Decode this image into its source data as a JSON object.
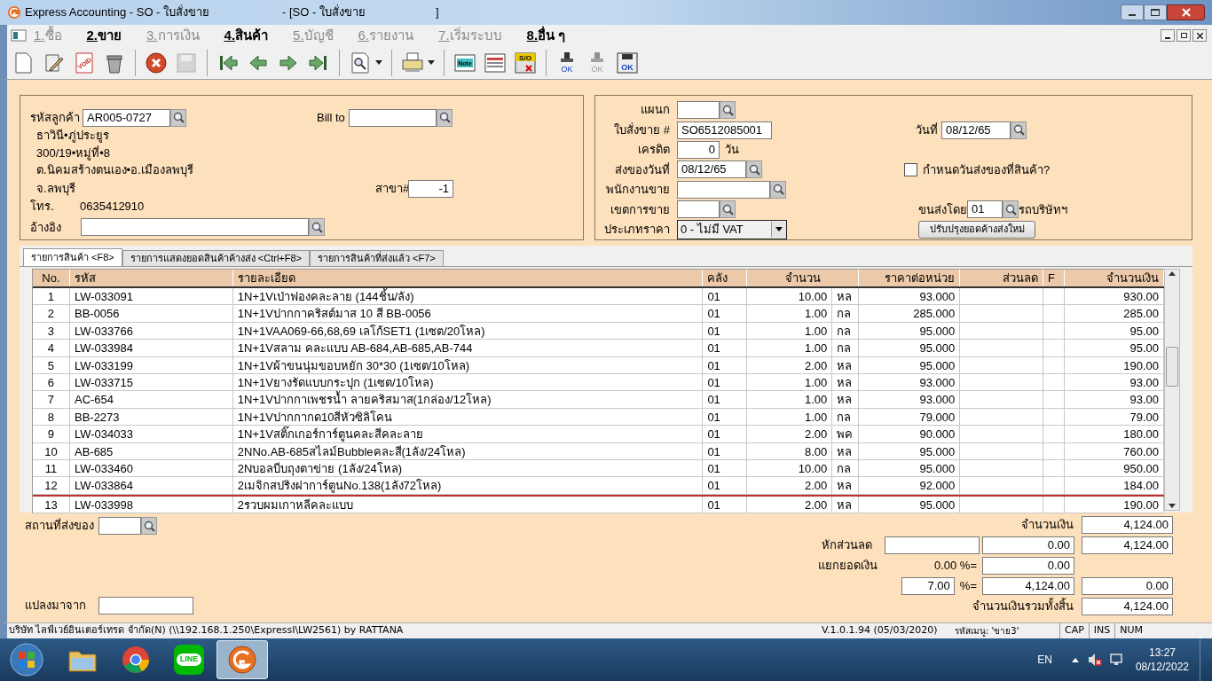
{
  "window": {
    "title": "Express Accounting - SO - ใบสั่งขาย",
    "doc_title": "- [SO - ใบสั่งขาย",
    "doc_title_end": "]"
  },
  "menu": [
    {
      "label": "1.ซื้อ",
      "disabled": true
    },
    {
      "label": "2.ขาย",
      "disabled": false
    },
    {
      "label": "3.การเงิน",
      "disabled": true
    },
    {
      "label": "4.สินค้า",
      "disabled": false
    },
    {
      "label": "5.บัญชี",
      "disabled": true
    },
    {
      "label": "6.รายงาน",
      "disabled": true
    },
    {
      "label": "7.เริ่มระบบ",
      "disabled": true
    },
    {
      "label": "8.อื่น ๆ",
      "disabled": false
    }
  ],
  "toolbar": [
    {
      "kind": "new",
      "disabled": false
    },
    {
      "kind": "edit",
      "disabled": false
    },
    {
      "kind": "void",
      "text": "VOID",
      "disabled": false
    },
    {
      "kind": "trash",
      "disabled": false
    },
    {
      "kind": "sep"
    },
    {
      "kind": "cancel",
      "disabled": false
    },
    {
      "kind": "save",
      "disabled": true
    },
    {
      "kind": "sep"
    },
    {
      "kind": "first",
      "disabled": false
    },
    {
      "kind": "prev",
      "disabled": false
    },
    {
      "kind": "next",
      "disabled": false
    },
    {
      "kind": "last",
      "disabled": false
    },
    {
      "kind": "sep"
    },
    {
      "kind": "find",
      "disabled": false,
      "dropdown": true
    },
    {
      "kind": "sep"
    },
    {
      "kind": "print",
      "disabled": false,
      "dropdown": true
    },
    {
      "kind": "sep"
    },
    {
      "kind": "note",
      "text": "Note",
      "disabled": false
    },
    {
      "kind": "form",
      "disabled": false
    },
    {
      "kind": "so",
      "text": "S/O",
      "disabled": false
    },
    {
      "kind": "sep"
    },
    {
      "kind": "stamp",
      "text": "OK",
      "disabled": false
    },
    {
      "kind": "stamp",
      "text": "OK",
      "disabled": true
    },
    {
      "kind": "okbox",
      "text": "OK",
      "disabled": false
    }
  ],
  "customer": {
    "code_label": "รหัสลูกค้า",
    "code": "AR005-0727",
    "bill_to_label": "Bill to",
    "address_lines": [
      "ธาวินี•ภู่ประยูร",
      "300/19•หมู่ที่•8",
      "ต.นิคมสร้างตนเอง•อ.เมืองลพบุรี",
      "จ.ลพบุรี"
    ],
    "branch_label": "สาขา#",
    "branch": "-1",
    "phone_label": "โทร.",
    "phone": "0635412910",
    "ref_label": "อ้างอิง"
  },
  "order": {
    "department_label": "แผนก",
    "so_label": "ใบสั่งขาย #",
    "so_number": "SO6512085001",
    "date_label": "วันที่",
    "date": "08/12/65",
    "credit_label": "เครดิต",
    "credit": "0",
    "credit_unit": "วัน",
    "ship_date_label": "ส่งของวันที่",
    "ship_date": "08/12/65",
    "set_ship_date": {
      "label": "กำหนดวันส่งของที่สินค้า?",
      "checked": false
    },
    "salesperson_label": "พนักงานขาย",
    "area_label": "เขตการขาย",
    "transport_label": "ขนส่งโดย",
    "transport_code": "01",
    "transport_name": "รถบริษัทฯ",
    "price_type_label": "ประเภทราคา",
    "price_type": "0 - ไม่มี VAT",
    "refresh_button": "ปรับปรุงยอดค้างส่งใหม่"
  },
  "tabs": [
    {
      "label": "รายการสินค้า <F8>",
      "selected": true
    },
    {
      "label": "รายการแสดงยอดสินค้าค้างส่ง  <Ctrl+F8>",
      "selected": false
    },
    {
      "label": "รายการสินค้าที่ส่งแล้ว <F7>",
      "selected": false
    }
  ],
  "table": {
    "columns": [
      "No.",
      "รหัส",
      "รายละเอียด",
      "คลัง",
      "จำนวน",
      "ราคาต่อหน่วย",
      "ส่วนลด",
      "F",
      "จำนวนเงิน"
    ],
    "rows": [
      {
        "no": "1",
        "code": "LW-033091",
        "desc": "1N+1Vเป่าฟองคละลาย (144ชิ้น/ลัง)",
        "wh": "01",
        "qty": "10.00",
        "unit": "หล",
        "price": "93.000",
        "amount": "930.00",
        "current": false
      },
      {
        "no": "2",
        "code": "BB-0056",
        "desc": "1N+1Vปากกาคริสต์มาส 10 สี BB-0056",
        "wh": "01",
        "qty": "1.00",
        "unit": "กล",
        "price": "285.000",
        "amount": "285.00",
        "current": false
      },
      {
        "no": "3",
        "code": "LW-033766",
        "desc": "1N+1VAA069-66,68,69 เลโก้SET1  (1เซต/20โหล)",
        "wh": "01",
        "qty": "1.00",
        "unit": "กล",
        "price": "95.000",
        "amount": "95.00",
        "current": false
      },
      {
        "no": "4",
        "code": "LW-033984",
        "desc": "1N+1Vสลาม คละแบบ AB-684,AB-685,AB-744",
        "wh": "01",
        "qty": "1.00",
        "unit": "กล",
        "price": "95.000",
        "amount": "95.00",
        "current": false
      },
      {
        "no": "5",
        "code": "LW-033199",
        "desc": "1N+1Vผ้าขนนุ่มขอบหยัก 30*30 (1เซต/10โหล)",
        "wh": "01",
        "qty": "2.00",
        "unit": "หล",
        "price": "95.000",
        "amount": "190.00",
        "current": false
      },
      {
        "no": "6",
        "code": "LW-033715",
        "desc": "1N+1Vยางรัดแบบกระปุก (1เซต/10โหล)",
        "wh": "01",
        "qty": "1.00",
        "unit": "หล",
        "price": "93.000",
        "amount": "93.00",
        "current": false
      },
      {
        "no": "7",
        "code": "AC-654",
        "desc": "1N+1Vปากกาเพชรน้ำ ลายคริสมาส(1กล่อง/12โหล)",
        "wh": "01",
        "qty": "1.00",
        "unit": "หล",
        "price": "93.000",
        "amount": "93.00",
        "current": false
      },
      {
        "no": "8",
        "code": "BB-2273",
        "desc": "1N+1Vปากกากด10สีหัวซิลิโคน",
        "wh": "01",
        "qty": "1.00",
        "unit": "กล",
        "price": "79.000",
        "amount": "79.00",
        "current": false
      },
      {
        "no": "9",
        "code": "LW-034033",
        "desc": "1N+1Vสติ๊กเกอร์การ์ตูนคละสีคละลาย",
        "wh": "01",
        "qty": "2.00",
        "unit": "พค",
        "price": "90.000",
        "amount": "180.00",
        "current": false
      },
      {
        "no": "10",
        "code": "AB-685",
        "desc": "2NNo.AB-685สไลม์Bubbleคละสี(1ลัง/24โหล)",
        "wh": "01",
        "qty": "8.00",
        "unit": "หล",
        "price": "95.000",
        "amount": "760.00",
        "current": false
      },
      {
        "no": "11",
        "code": "LW-033460",
        "desc": "2Nบอลบีบถุงตาข่าย (1ลัง/24โหล)",
        "wh": "01",
        "qty": "10.00",
        "unit": "กล",
        "price": "95.000",
        "amount": "950.00",
        "current": false
      },
      {
        "no": "12",
        "code": "LW-033864",
        "desc": "2เมจิกสปริงฝาการ์ตูนNo.138(1ลัง72โหล)",
        "wh": "01",
        "qty": "2.00",
        "unit": "หล",
        "price": "92.000",
        "amount": "184.00",
        "current": false
      },
      {
        "no": "13",
        "code": "LW-033998",
        "desc": "2รวบผมเกาหลีคละแบบ",
        "wh": "01",
        "qty": "2.00",
        "unit": "หล",
        "price": "95.000",
        "amount": "190.00",
        "current": true
      }
    ]
  },
  "footer": {
    "ship_place_label": "สถานที่ส่งของ",
    "converted_from_label": "แปลงมาจาก",
    "amount_label": "จำนวนเงิน",
    "amount": "4,124.00",
    "discount_label": "หักส่วนลด",
    "discount": "0.00",
    "after_discount": "4,124.00",
    "split_label": "แยกยอดเงิน",
    "split_percent": "0.00 %=",
    "split_amount": "0.00",
    "vat_rate": "7.00",
    "vat_sign": "%=",
    "vat_base": "4,124.00",
    "vat_amount": "0.00",
    "total_label": "จำนวนเงินรวมทั้งสิ้น",
    "total": "4,124.00"
  },
  "status_bar": {
    "company": "บริษัท ไลฟ์เวย์อินเตอร์เทรด จำกัด(N) (\\\\192.168.1.250\\ExpressI\\LW2561) by RATTANA",
    "version": "V.1.0.1.94 (05/03/2020)",
    "menu_code": "รหัสเมนู: 'ขาย3'",
    "indicators": [
      "CAP",
      "INS",
      "NUM"
    ]
  },
  "taskbar": {
    "apps": [
      {
        "kind": "explorer",
        "selected": false
      },
      {
        "kind": "chrome",
        "selected": false
      },
      {
        "kind": "line",
        "text": "LINE",
        "selected": false
      },
      {
        "kind": "express",
        "selected": true
      }
    ],
    "language": "EN",
    "time": "13:27",
    "date": "08/12/2022"
  }
}
